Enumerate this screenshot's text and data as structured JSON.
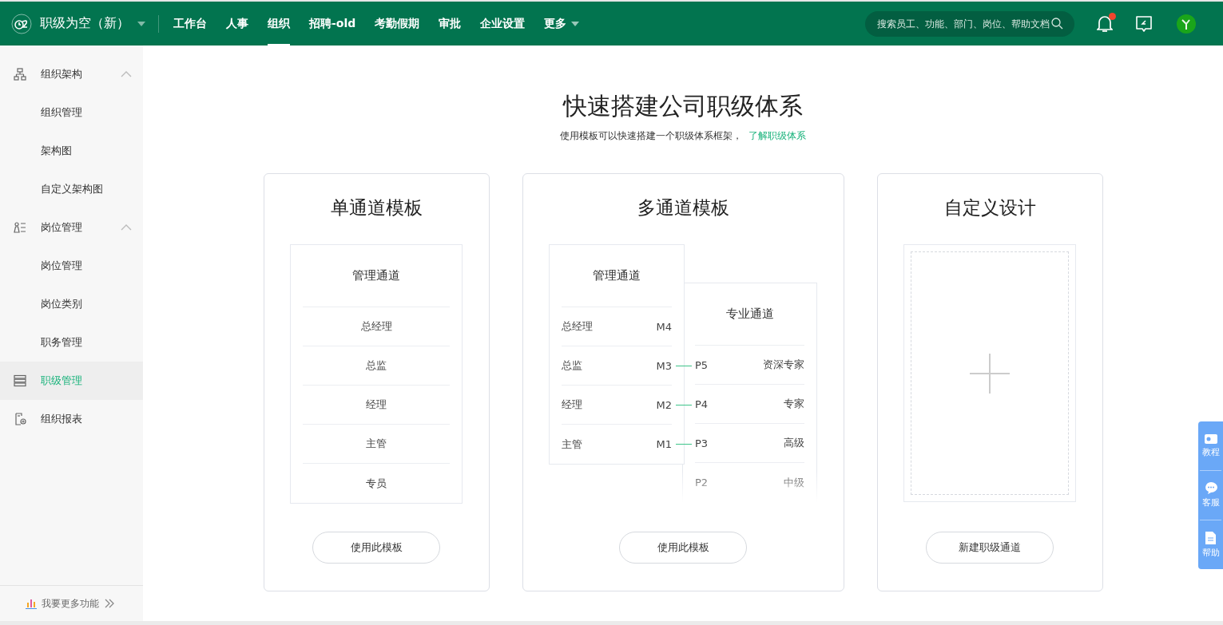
{
  "header": {
    "company": "职级为空（新）",
    "nav": [
      {
        "label": "工作台",
        "selected": false
      },
      {
        "label": "人事",
        "selected": false
      },
      {
        "label": "组织",
        "selected": true
      },
      {
        "label": "招聘-old",
        "selected": false
      },
      {
        "label": "考勤假期",
        "selected": false
      },
      {
        "label": "审批",
        "selected": false
      },
      {
        "label": "企业设置",
        "selected": false
      }
    ],
    "more": "更多",
    "search": {
      "placeholder": "搜索员工、功能、部门、岗位、帮助文档"
    },
    "notification_badge": true
  },
  "sidebar": {
    "items": [
      {
        "kind": "group",
        "label": "组织架构",
        "expanded": true,
        "selected": false,
        "children": [
          {
            "label": "组织管理",
            "selected": false
          },
          {
            "label": "架构图",
            "selected": false
          },
          {
            "label": "自定义架构图",
            "selected": false
          }
        ]
      },
      {
        "kind": "group",
        "label": "岗位管理",
        "expanded": true,
        "selected": false,
        "children": [
          {
            "label": "岗位管理",
            "selected": false
          },
          {
            "label": "岗位类别",
            "selected": false
          },
          {
            "label": "职务管理",
            "selected": false
          }
        ]
      },
      {
        "kind": "item",
        "label": "职级管理",
        "selected": true
      },
      {
        "kind": "item",
        "label": "组织报表",
        "selected": false
      }
    ],
    "footer": "我要更多功能"
  },
  "main": {
    "title": "快速搭建公司职级体系",
    "subtitle": "使用模板可以快速搭建一个职级体系框架，",
    "link": "了解职级体系",
    "cards": [
      {
        "kind": "single",
        "title": "单通道模板",
        "channel": {
          "title": "管理通道",
          "rows": [
            {
              "name": "总经理"
            },
            {
              "name": "总监"
            },
            {
              "name": "经理"
            },
            {
              "name": "主管"
            },
            {
              "name": "专员"
            }
          ]
        },
        "button": "使用此模板"
      },
      {
        "kind": "multi",
        "title": "多通道模板",
        "management": {
          "title": "管理通道",
          "rows": [
            {
              "name": "总经理",
              "code": "M4",
              "linked": false
            },
            {
              "name": "总监",
              "code": "M3",
              "linked": true
            },
            {
              "name": "经理",
              "code": "M2",
              "linked": true
            },
            {
              "name": "主管",
              "code": "M1",
              "linked": true
            }
          ]
        },
        "professional": {
          "title": "专业通道",
          "rows": [
            {
              "code": "P5",
              "name": "资深专家"
            },
            {
              "code": "P4",
              "name": "专家"
            },
            {
              "code": "P3",
              "name": "高级"
            },
            {
              "code": "P2",
              "name": "中级"
            }
          ]
        },
        "button": "使用此模板"
      },
      {
        "kind": "custom",
        "title": "自定义设计",
        "button": "新建职级通道"
      }
    ]
  },
  "help_bar": {
    "items": [
      {
        "label": "教程"
      },
      {
        "label": "客服"
      },
      {
        "label": "帮助"
      }
    ]
  }
}
